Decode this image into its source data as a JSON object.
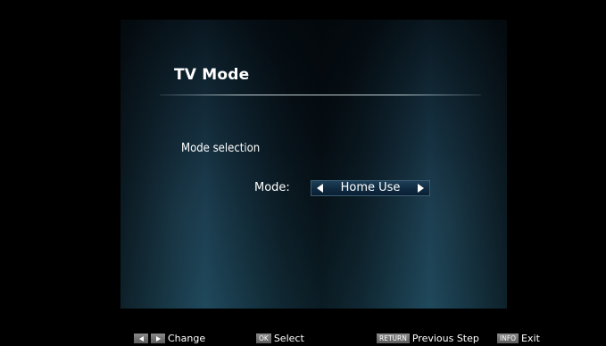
{
  "menu": {
    "title": "TV Mode",
    "section_label": "Mode selection",
    "mode_label": "Mode:",
    "mode_value": "Home Use"
  },
  "footer": {
    "change_label": "Change",
    "ok_key": "OK",
    "select_label": "Select",
    "return_key": "RETURN",
    "previous_step_label": "Previous Step",
    "info_key": "INFO",
    "exit_label": "Exit"
  }
}
